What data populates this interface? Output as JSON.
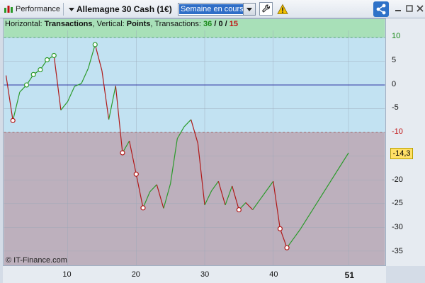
{
  "toolbar": {
    "performance_label": "Performance",
    "instrument_label": "Allemagne 30 Cash (1€)",
    "period_value": "Semaine en cours"
  },
  "header": {
    "horizontal_prefix": "Horizontal: ",
    "horizontal_value": "Transactions",
    "vertical_prefix": ", Vertical: ",
    "vertical_value": "Points",
    "transactions_prefix": ", Transactions: ",
    "count_win": "36",
    "count_sep1": " / ",
    "count_mid": "0",
    "count_sep2": " / ",
    "count_loss": "15"
  },
  "copyright": "© IT-Finance.com",
  "colors": {
    "positive_zone": "#c2e2f2",
    "negative_zone": "#bdb0bd",
    "top_band": "#a8e0b8",
    "zero_line": "#1a1a9a",
    "line_up": "#2a9a2a",
    "line_down": "#b01818",
    "accent": "#2e72c8"
  },
  "chart_data": {
    "type": "line",
    "xlim": [
      1,
      56
    ],
    "ylim": [
      -38,
      11.5
    ],
    "x_ticks": [
      {
        "value": 10,
        "label": "10",
        "bold": false
      },
      {
        "value": 20,
        "label": "20",
        "bold": false
      },
      {
        "value": 30,
        "label": "30",
        "bold": false
      },
      {
        "value": 40,
        "label": "40",
        "bold": false
      },
      {
        "value": 51,
        "label": "51",
        "bold": true
      }
    ],
    "y_ticks": [
      {
        "value": 10,
        "label": "10",
        "style": "green"
      },
      {
        "value": 5,
        "label": "5",
        "style": ""
      },
      {
        "value": 0,
        "label": "0",
        "style": ""
      },
      {
        "value": -5,
        "label": "-5",
        "style": ""
      },
      {
        "value": -10,
        "label": "-10",
        "style": "red"
      },
      {
        "value": -15,
        "label": "-15",
        "style": ""
      },
      {
        "value": -20,
        "label": "-20",
        "style": ""
      },
      {
        "value": -25,
        "label": "-25",
        "style": ""
      },
      {
        "value": -30,
        "label": "-30",
        "style": ""
      },
      {
        "value": -35,
        "label": "-35",
        "style": ""
      }
    ],
    "upper_threshold": 10,
    "lower_threshold": -10,
    "last_value_label": "-14,3",
    "last_value": -14.3,
    "grid": true,
    "points": [
      {
        "x": 1,
        "y": 2.0
      },
      {
        "x": 2,
        "y": -7.5,
        "marker": "red"
      },
      {
        "x": 3,
        "y": -1.5
      },
      {
        "x": 4,
        "y": 0.0,
        "marker": "green"
      },
      {
        "x": 5,
        "y": 2.2,
        "marker": "green"
      },
      {
        "x": 6,
        "y": 3.2,
        "marker": "green"
      },
      {
        "x": 7,
        "y": 5.3,
        "marker": "green"
      },
      {
        "x": 8,
        "y": 6.2,
        "marker": "green"
      },
      {
        "x": 9,
        "y": -5.3
      },
      {
        "x": 10,
        "y": -3.5
      },
      {
        "x": 11,
        "y": -0.3
      },
      {
        "x": 12,
        "y": 0.3
      },
      {
        "x": 13,
        "y": 3.5
      },
      {
        "x": 14,
        "y": 8.5,
        "marker": "green"
      },
      {
        "x": 15,
        "y": 3.0
      },
      {
        "x": 16,
        "y": -7.3
      },
      {
        "x": 17,
        "y": -0.2
      },
      {
        "x": 18,
        "y": -14.3,
        "marker": "red"
      },
      {
        "x": 19,
        "y": -11.8
      },
      {
        "x": 20,
        "y": -18.8,
        "marker": "red"
      },
      {
        "x": 21,
        "y": -25.9,
        "marker": "red"
      },
      {
        "x": 22,
        "y": -22.5
      },
      {
        "x": 23,
        "y": -21.0
      },
      {
        "x": 24,
        "y": -26.0
      },
      {
        "x": 25,
        "y": -20.8
      },
      {
        "x": 26,
        "y": -11.3
      },
      {
        "x": 27,
        "y": -8.8
      },
      {
        "x": 28,
        "y": -7.3
      },
      {
        "x": 29,
        "y": -12.3
      },
      {
        "x": 30,
        "y": -25.3
      },
      {
        "x": 31,
        "y": -22.3
      },
      {
        "x": 32,
        "y": -20.3
      },
      {
        "x": 33,
        "y": -25.3
      },
      {
        "x": 34,
        "y": -21.3
      },
      {
        "x": 35,
        "y": -26.3,
        "marker": "red"
      },
      {
        "x": 36,
        "y": -24.8
      },
      {
        "x": 37,
        "y": -26.3
      },
      {
        "x": 38,
        "y": -24.3
      },
      {
        "x": 40,
        "y": -20.3
      },
      {
        "x": 41,
        "y": -30.3,
        "marker": "red"
      },
      {
        "x": 42,
        "y": -34.3,
        "marker": "red"
      },
      {
        "x": 44,
        "y": -30.3
      },
      {
        "x": 51,
        "y": -14.3
      }
    ]
  }
}
